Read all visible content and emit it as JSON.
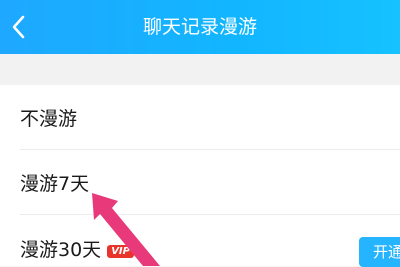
{
  "header": {
    "title": "聊天记录漫游",
    "back_icon": "chevron-left-icon",
    "background": "#1ea8ff"
  },
  "options": [
    {
      "label": "不漫游"
    },
    {
      "label": "漫游7天"
    },
    {
      "label": "漫游30天",
      "badge": "VIP"
    }
  ],
  "open_button": {
    "label": "开通"
  },
  "annotation": {
    "icon": "pink-arrow-pointer",
    "color": "#e8397a"
  }
}
